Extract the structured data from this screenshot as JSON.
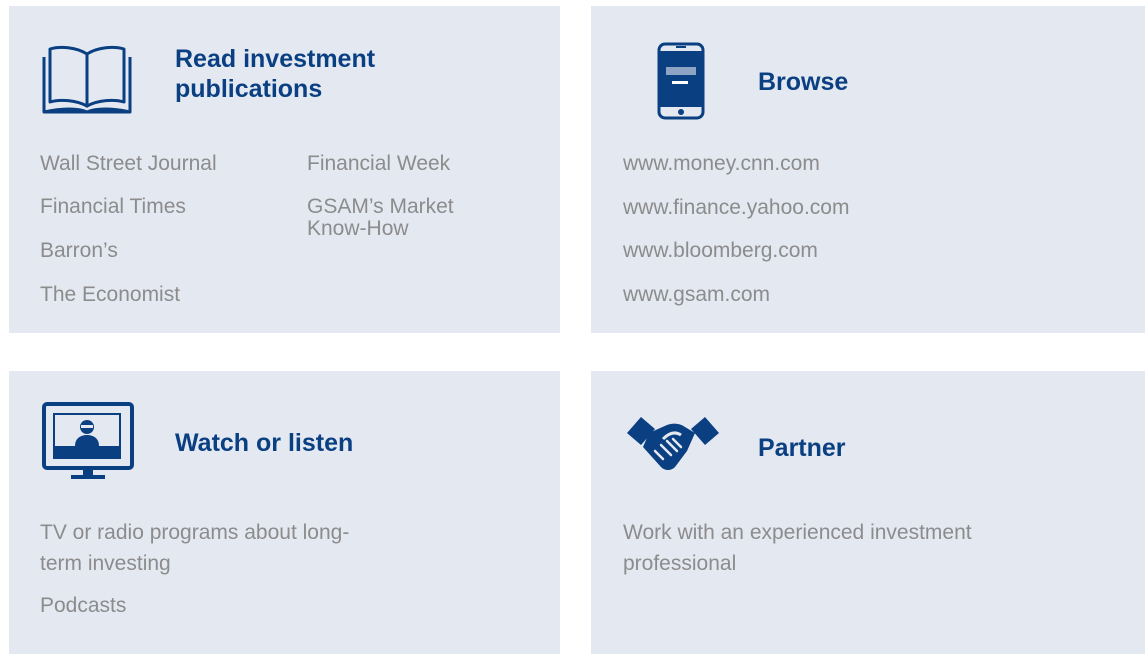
{
  "cards": {
    "read": {
      "title_line1": "Read investment",
      "title_line2": "publications",
      "icon": "open-book-icon",
      "left_column": [
        "Wall Street Journal",
        "Financial Times",
        "Barron’s",
        "The Economist"
      ],
      "right_column": [
        "Financial Week",
        "GSAM’s Market Know-How"
      ]
    },
    "browse": {
      "title": "Browse",
      "icon": "smartphone-icon",
      "items": [
        "www.money.cnn.com",
        "www.finance.yahoo.com",
        "www.bloomberg.com",
        "www.gsam.com"
      ]
    },
    "watch": {
      "title": "Watch or listen",
      "icon": "tv-presenter-icon",
      "items": [
        "TV or radio programs about long-term investing",
        "Podcasts"
      ]
    },
    "partner": {
      "title": "Partner",
      "icon": "handshake-icon",
      "items": [
        "Work with an experienced investment professional"
      ]
    }
  },
  "colors": {
    "card_background": "#e3e8f1",
    "title": "#0a3f82",
    "icon": "#0a3f82",
    "body_text": "#8c8c8c"
  }
}
